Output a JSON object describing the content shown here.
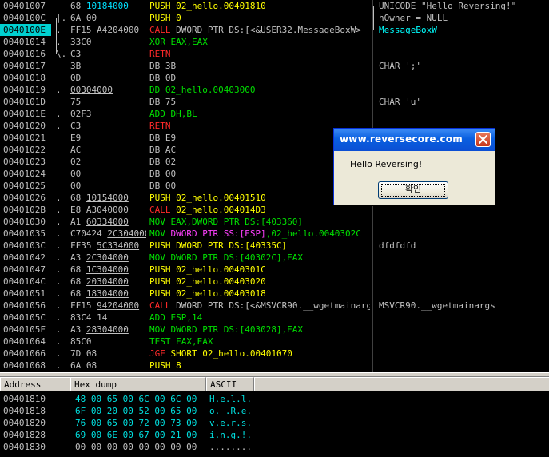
{
  "disasm": {
    "rows": [
      {
        "addr": "00401007",
        "mark": "",
        "hex": "68 ",
        "hexu": "10184000",
        "hexu_cyan": true,
        "ins": [
          {
            "t": "PUSH 02_hello.00401810",
            "k": "push"
          }
        ],
        "cmt": "UNICODE \"Hello Reversing!\""
      },
      {
        "addr": "0040100C",
        "mark": "|.",
        "hex": "6A 00",
        "ins": [
          {
            "t": "PUSH 0",
            "k": "push"
          }
        ],
        "cmt": "hOwner = NULL"
      },
      {
        "addr": "0040100E",
        "mark": ".",
        "hex": "FF15 ",
        "hexu": "A4204000",
        "ins": [
          {
            "t": "CALL",
            "k": "call"
          },
          {
            "t": " DWORD PTR DS:[<&USER32.MessageBoxW>",
            "k": "db"
          }
        ],
        "cmt": "MessageBoxW",
        "sel": true
      },
      {
        "addr": "00401014",
        "mark": ".",
        "hex": "33C0",
        "ins": [
          {
            "t": "XOR EAX,EAX",
            "k": "xor"
          }
        ],
        "cmt": ""
      },
      {
        "addr": "00401016",
        "mark": "\\.",
        "hex": "C3",
        "ins": [
          {
            "t": "RETN",
            "k": "retn"
          }
        ],
        "cmt": ""
      },
      {
        "addr": "00401017",
        "mark": "",
        "hex": "3B",
        "ins": [
          {
            "t": "DB 3B",
            "k": "db"
          }
        ],
        "cmt": "CHAR ';'"
      },
      {
        "addr": "00401018",
        "mark": "",
        "hex": "0D",
        "ins": [
          {
            "t": "DB 0D",
            "k": "db"
          }
        ],
        "cmt": ""
      },
      {
        "addr": "00401019",
        "mark": ".",
        "hex": "",
        "hexu": "00304000",
        "ins": [
          {
            "t": "DD 02_hello.00403000",
            "k": "dd"
          }
        ],
        "cmt": ""
      },
      {
        "addr": "0040101D",
        "mark": "",
        "hex": "75",
        "ins": [
          {
            "t": "DB 75",
            "k": "db"
          }
        ],
        "cmt": "CHAR 'u'"
      },
      {
        "addr": "0040101E",
        "mark": ".",
        "hex": "02F3",
        "ins": [
          {
            "t": "ADD DH,BL",
            "k": "add"
          }
        ],
        "cmt": ""
      },
      {
        "addr": "00401020",
        "mark": ".",
        "hex": "C3",
        "ins": [
          {
            "t": "RETN",
            "k": "retn"
          }
        ],
        "cmt": ""
      },
      {
        "addr": "00401021",
        "mark": "",
        "hex": "E9",
        "ins": [
          {
            "t": "DB E9",
            "k": "db"
          }
        ],
        "cmt": ""
      },
      {
        "addr": "00401022",
        "mark": "",
        "hex": "AC",
        "ins": [
          {
            "t": "DB AC",
            "k": "db"
          }
        ],
        "cmt": ""
      },
      {
        "addr": "00401023",
        "mark": "",
        "hex": "02",
        "ins": [
          {
            "t": "DB 02",
            "k": "db"
          }
        ],
        "cmt": ""
      },
      {
        "addr": "00401024",
        "mark": "",
        "hex": "00",
        "ins": [
          {
            "t": "DB 00",
            "k": "db"
          }
        ],
        "cmt": ""
      },
      {
        "addr": "00401025",
        "mark": "",
        "hex": "00",
        "ins": [
          {
            "t": "DB 00",
            "k": "db"
          }
        ],
        "cmt": ""
      },
      {
        "addr": "00401026",
        "mark": ".",
        "hex": "68 ",
        "hexu": "10154000",
        "ins": [
          {
            "t": "PUSH 02_hello.00401510",
            "k": "push"
          }
        ],
        "cmt": ""
      },
      {
        "addr": "0040102B",
        "mark": ".",
        "hex": "E8 A3040000",
        "ins": [
          {
            "t": "CALL",
            "k": "call"
          },
          {
            "t": " 02_hello.004014D3",
            "k": "push"
          }
        ],
        "cmt": ""
      },
      {
        "addr": "00401030",
        "mark": ".",
        "hex": "A1 ",
        "hexu": "60334000",
        "ins": [
          {
            "t": "MOV EAX,DWORD PTR DS:[403360]",
            "k": "mov"
          }
        ],
        "cmt": ""
      },
      {
        "addr": "00401035",
        "mark": ".",
        "hex": "C70424 ",
        "hexu": "2C304000",
        "ins": [
          {
            "t": "MOV",
            "k": "mov"
          },
          {
            "t": " DWORD PTR SS:[ESP]",
            "k": "mag"
          },
          {
            "t": ",02_hello.0040302C",
            "k": "mov"
          }
        ],
        "cmt": ""
      },
      {
        "addr": "0040103C",
        "mark": ".",
        "hex": "FF35 ",
        "hexu": "5C334000",
        "ins": [
          {
            "t": "PUSH DWORD PTR DS:[40335C]",
            "k": "push"
          }
        ],
        "cmt": "dfdfdfd"
      },
      {
        "addr": "00401042",
        "mark": ".",
        "hex": "A3 ",
        "hexu": "2C304000",
        "ins": [
          {
            "t": "MOV DWORD PTR DS:[40302C],EAX",
            "k": "mov"
          }
        ],
        "cmt": ""
      },
      {
        "addr": "00401047",
        "mark": ".",
        "hex": "68 ",
        "hexu": "1C304000",
        "ins": [
          {
            "t": "PUSH 02_hello.0040301C",
            "k": "push"
          }
        ],
        "cmt": ""
      },
      {
        "addr": "0040104C",
        "mark": ".",
        "hex": "68 ",
        "hexu": "20304000",
        "ins": [
          {
            "t": "PUSH 02_hello.00403020",
            "k": "push"
          }
        ],
        "cmt": ""
      },
      {
        "addr": "00401051",
        "mark": ".",
        "hex": "68 ",
        "hexu": "18304000",
        "ins": [
          {
            "t": "PUSH 02_hello.00403018",
            "k": "push"
          }
        ],
        "cmt": ""
      },
      {
        "addr": "00401056",
        "mark": ".",
        "hex": "FF15 ",
        "hexu": "94204000",
        "ins": [
          {
            "t": "CALL",
            "k": "call"
          },
          {
            "t": " DWORD PTR DS:[<&MSVCR90.__wgetmainargs>",
            "k": "db"
          }
        ],
        "cmt": "MSVCR90.__wgetmainargs"
      },
      {
        "addr": "0040105C",
        "mark": ".",
        "hex": "83C4 14",
        "ins": [
          {
            "t": "ADD ESP,14",
            "k": "add"
          }
        ],
        "cmt": ""
      },
      {
        "addr": "0040105F",
        "mark": ".",
        "hex": "A3 ",
        "hexu": "28304000",
        "ins": [
          {
            "t": "MOV DWORD PTR DS:[403028],EAX",
            "k": "mov"
          }
        ],
        "cmt": ""
      },
      {
        "addr": "00401064",
        "mark": ".",
        "hex": "85C0",
        "ins": [
          {
            "t": "TEST EAX,EAX",
            "k": "test"
          }
        ],
        "cmt": ""
      },
      {
        "addr": "00401066",
        "mark": ".",
        "hex": "7D 08",
        "ins": [
          {
            "t": "JGE",
            "k": "jmp"
          },
          {
            "t": " SHORT 02_hello.00401070",
            "k": "push"
          }
        ],
        "cmt": ""
      },
      {
        "addr": "00401068",
        "mark": ".",
        "hex": "6A 08",
        "ins": [
          {
            "t": "PUSH 8",
            "k": "push"
          }
        ],
        "cmt": ""
      }
    ]
  },
  "dump": {
    "headers": {
      "address": "Address",
      "hex": "Hex dump",
      "ascii": "ASCII"
    },
    "rows": [
      {
        "addr": "00401810",
        "hex": "48 00 65 00 6C 00 6C 00",
        "ascii": "H.e.l.l.",
        "dim": false
      },
      {
        "addr": "00401818",
        "hex": "6F 00 20 00 52 00 65 00",
        "ascii": "o. .R.e.",
        "dim": false
      },
      {
        "addr": "00401820",
        "hex": "76 00 65 00 72 00 73 00",
        "ascii": "v.e.r.s.",
        "dim": false
      },
      {
        "addr": "00401828",
        "hex": "69 00 6E 00 67 00 21 00",
        "ascii": "i.n.g.!.",
        "dim": false
      },
      {
        "addr": "00401830",
        "hex": "00 00 00 00 00 00 00 00",
        "ascii": "........",
        "dim": true
      }
    ]
  },
  "msgbox": {
    "title": "www.reversecore.com",
    "message": "Hello Reversing!",
    "ok_label": "확인",
    "close_icon": "close-x-icon"
  }
}
